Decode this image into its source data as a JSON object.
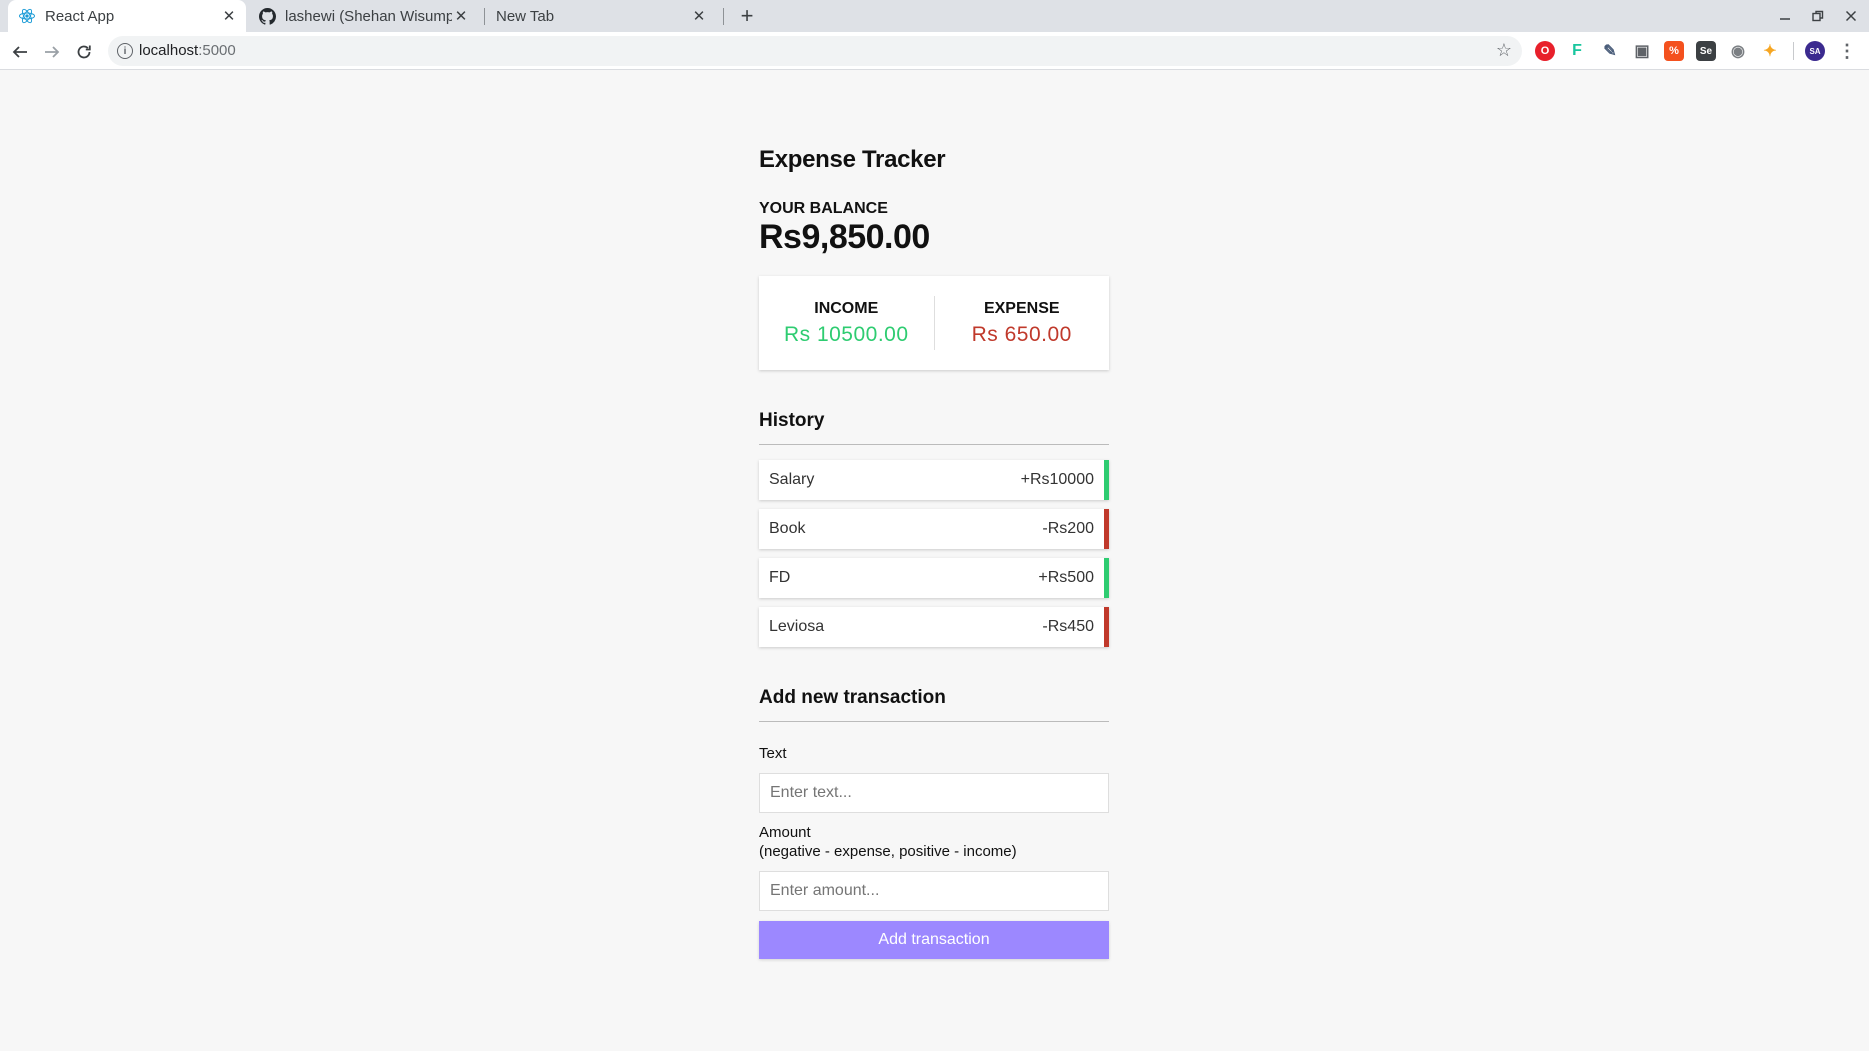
{
  "browser": {
    "tabs": [
      {
        "title": "React App",
        "active": true
      },
      {
        "title": "lashewi (Shehan Wisump",
        "active": false
      },
      {
        "title": "New Tab",
        "active": false
      }
    ],
    "address": {
      "host": "localhost",
      "port": ":5000"
    },
    "colors": {
      "tabstrip": "#dee1e6",
      "toolbar": "#ffffff"
    },
    "extensions": [
      {
        "name": "opera-icon",
        "color": "#e8202b",
        "label": "O"
      },
      {
        "name": "feather-extension-icon",
        "color": "#18c69e",
        "label": "F"
      },
      {
        "name": "tools-extension-icon",
        "color": "#4a5d7a",
        "label": "✎"
      },
      {
        "name": "box-extension-icon",
        "color": "#5f6368",
        "label": "▣"
      },
      {
        "name": "percent-extension-icon",
        "color": "#f4511e",
        "label": "%"
      },
      {
        "name": "se-extension-icon",
        "color": "#3c4043",
        "label": "Se"
      },
      {
        "name": "camera-extension-icon",
        "color": "#7b7f83",
        "label": "◉"
      },
      {
        "name": "bird-extension-icon",
        "color": "#f6a623",
        "label": "✦"
      }
    ],
    "profile": {
      "label": "SA",
      "color": "#3b2a8f"
    }
  },
  "app": {
    "title": "Expense Tracker",
    "balance_label": "YOUR BALANCE",
    "balance": "Rs9,850.00",
    "income_label": "INCOME",
    "income": "Rs 10500.00",
    "expense_label": "EXPENSE",
    "expense": "Rs 650.00",
    "colors": {
      "plus": "#2ecc71",
      "minus": "#c0392b",
      "accent": "#9c88ff"
    },
    "history_title": "History",
    "transactions": [
      {
        "text": "Salary",
        "amount": "+Rs10000",
        "type": "plus"
      },
      {
        "text": "Book",
        "amount": "-Rs200",
        "type": "minus"
      },
      {
        "text": "FD",
        "amount": "+Rs500",
        "type": "plus"
      },
      {
        "text": "Leviosa",
        "amount": "-Rs450",
        "type": "minus"
      }
    ],
    "add_title": "Add new transaction",
    "text_label": "Text",
    "text_placeholder": "Enter text...",
    "amount_label": "Amount",
    "amount_hint": "(negative - expense, positive - income)",
    "amount_placeholder": "Enter amount...",
    "submit_label": "Add transaction"
  }
}
